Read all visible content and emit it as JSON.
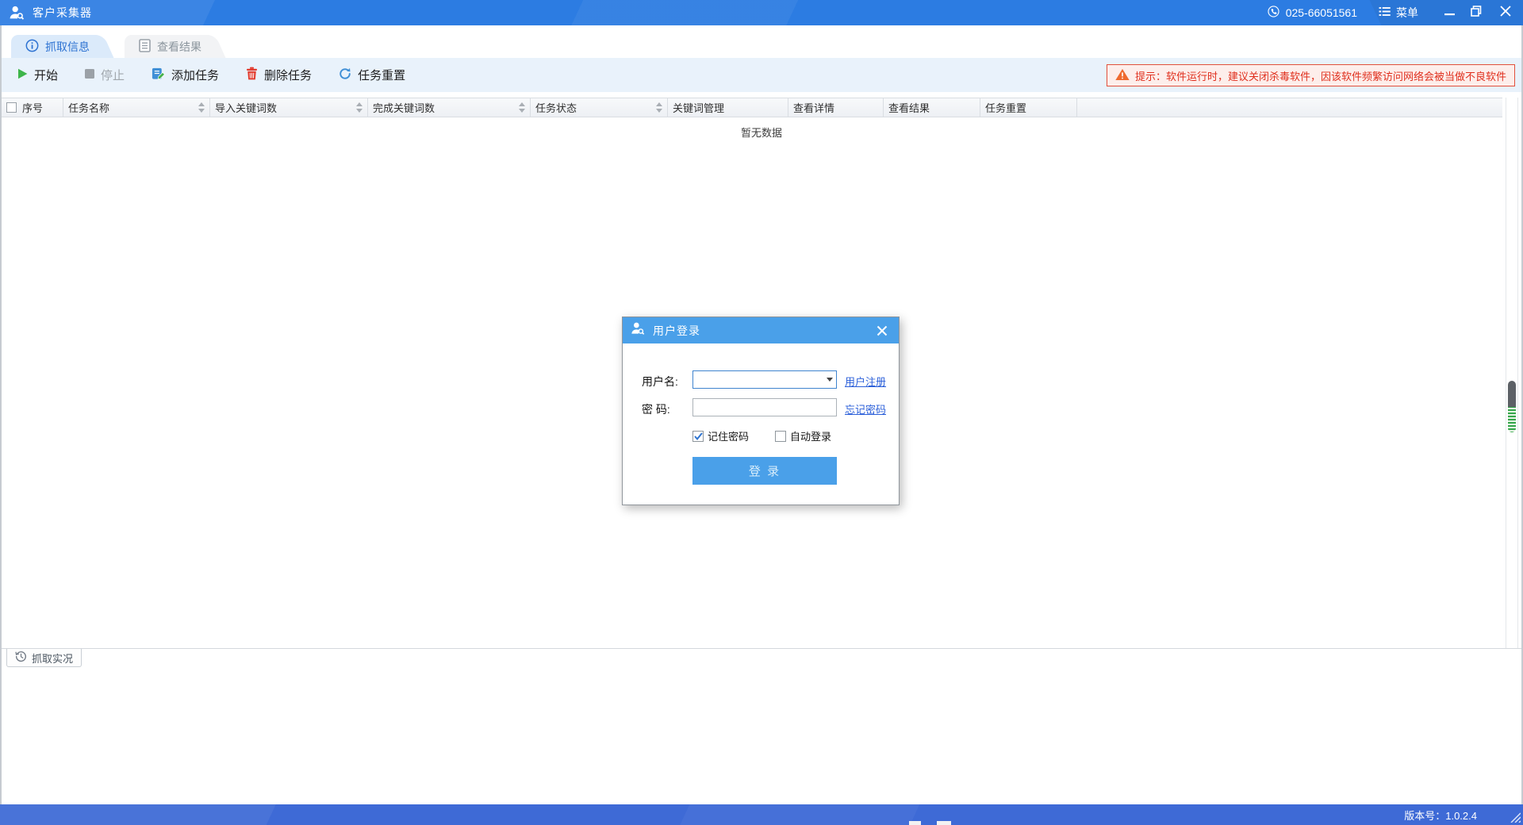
{
  "titlebar": {
    "title": "客户采集器",
    "phone": "025-66051561",
    "menu_label": "菜单",
    "icons": {
      "app": "user-search-icon",
      "phone": "phone-icon",
      "menu": "menu-list-icon",
      "minimize": "minimize-icon",
      "maximize": "maximize-restore-icon",
      "close": "close-icon"
    }
  },
  "tabs": [
    {
      "label": "抓取信息",
      "icon": "info-icon",
      "active": true
    },
    {
      "label": "查看结果",
      "icon": "document-icon",
      "active": false
    }
  ],
  "toolbar": {
    "start": {
      "label": "开始",
      "icon": "play-icon",
      "disabled": false
    },
    "stop": {
      "label": "停止",
      "icon": "stop-icon",
      "disabled": true
    },
    "add": {
      "label": "添加任务",
      "icon": "add-task-icon",
      "disabled": false
    },
    "remove": {
      "label": "删除任务",
      "icon": "delete-trash-icon",
      "disabled": false
    },
    "reset": {
      "label": "任务重置",
      "icon": "reset-circular-arrow-icon",
      "disabled": false
    },
    "warning": {
      "icon": "warning-triangle-icon",
      "text": "提示：软件运行时，建议关闭杀毒软件，因该软件频繁访问网络会被当做不良软件"
    }
  },
  "table": {
    "columns": [
      {
        "label": "序号",
        "sortable": false
      },
      {
        "label": "任务名称",
        "sortable": true
      },
      {
        "label": "导入关键词数",
        "sortable": true
      },
      {
        "label": "完成关键词数",
        "sortable": true
      },
      {
        "label": "任务状态",
        "sortable": true
      },
      {
        "label": "关键词管理",
        "sortable": false
      },
      {
        "label": "查看详情",
        "sortable": false
      },
      {
        "label": "查看结果",
        "sortable": false
      },
      {
        "label": "任务重置",
        "sortable": false
      }
    ],
    "empty_text": "暂无数据",
    "header_checkbox_checked": false
  },
  "login": {
    "title": "用户登录",
    "title_icon": "user-search-icon",
    "close_icon": "close-icon",
    "username_label": "用户名:",
    "username_value": "",
    "password_label": "密 码:",
    "password_value": "",
    "register_link": "用户注册",
    "forgot_link": "忘记密码",
    "remember_label": "记住密码",
    "remember_checked": true,
    "autologin_label": "自动登录",
    "autologin_checked": false,
    "submit_label": "登 录"
  },
  "bottom_panel": {
    "tab_label": "抓取实况",
    "tab_icon": "history-clock-icon"
  },
  "statusbar": {
    "version_label": "版本号：1.0.2.4",
    "grip_icon": "resize-grip-icon"
  },
  "colors": {
    "titlebar_blue": "#2C7CE2",
    "statusbar_blue": "#3E6AD6",
    "accent_blue": "#4AA0E9",
    "tab_active_bg": "#DBEAFA",
    "tab_active_text": "#2E73D2",
    "toolbar_bg": "#E9F2FB",
    "warning_text": "#E0301E",
    "warning_bg": "#FDEEEB",
    "warning_border": "#E1503C",
    "link_blue": "#2B5FD9",
    "start_green": "#3DB54A",
    "delete_red": "#E23B2E",
    "scroll_thumb_gray": "#5D6166",
    "scroll_thumb_green": "#35A54A"
  }
}
